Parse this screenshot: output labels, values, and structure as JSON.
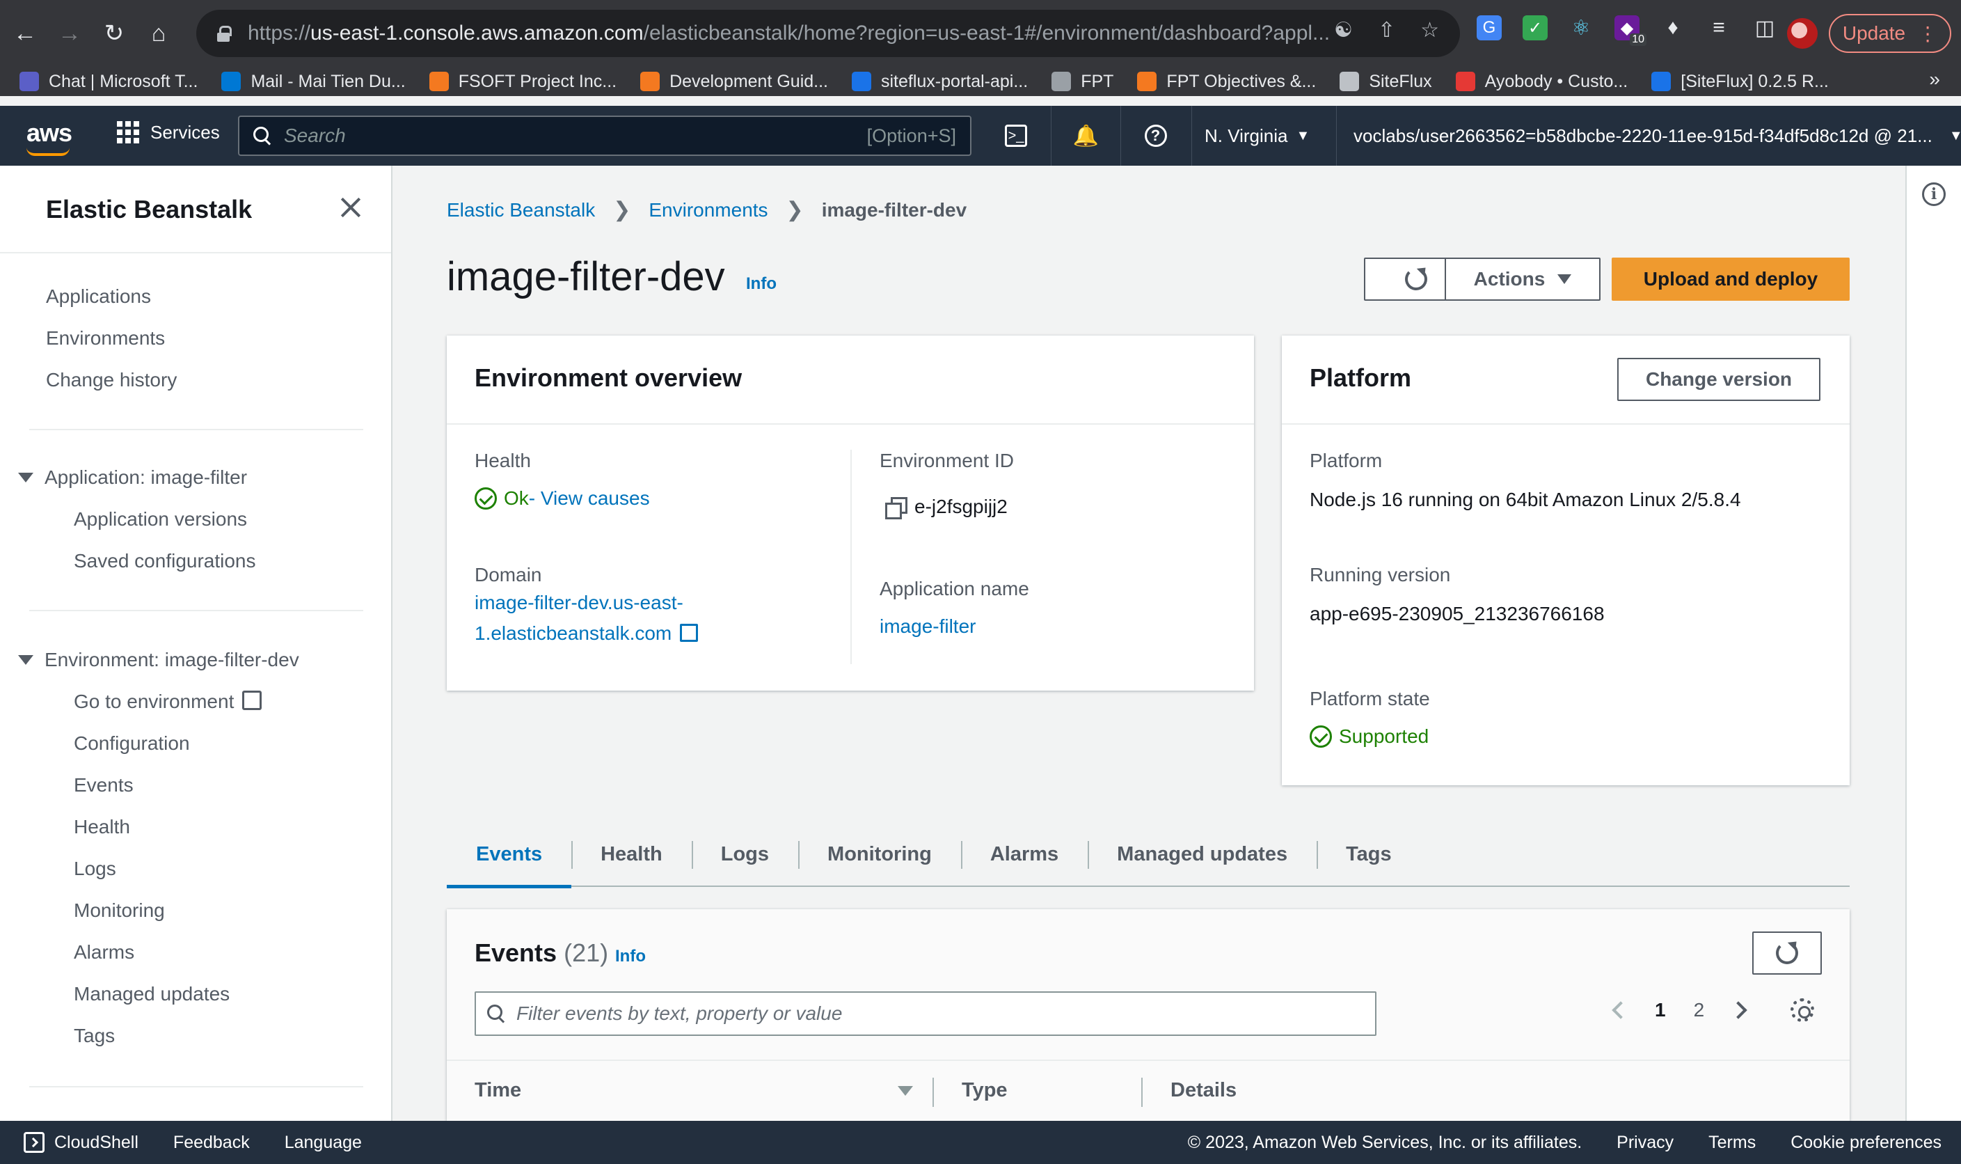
{
  "browser": {
    "url_prefix": "https://",
    "url_host": "us-east-1.console.aws.amazon.com",
    "url_path": "/elasticbeanstalk/home?region=us-east-1#/environment/dashboard?appl...",
    "update_label": "Update",
    "extension_badge": "10",
    "bookmarks": [
      {
        "label": "Chat | Microsoft T...",
        "color": "#5b5fc7"
      },
      {
        "label": "Mail - Mai Tien Du...",
        "color": "#0078d4"
      },
      {
        "label": "FSOFT Project Inc...",
        "color": "#f47920"
      },
      {
        "label": "Development Guid...",
        "color": "#f47920"
      },
      {
        "label": "siteflux-portal-api...",
        "color": "#1a73e8"
      },
      {
        "label": "FPT",
        "color": "#9aa0a6"
      },
      {
        "label": "FPT Objectives &...",
        "color": "#f47920"
      },
      {
        "label": "SiteFlux",
        "color": "#bdc1c6"
      },
      {
        "label": "Ayobody • Custo...",
        "color": "#e53935"
      },
      {
        "label": "[SiteFlux] 0.2.5 R...",
        "color": "#1a73e8"
      }
    ],
    "bookmarks_more": "»"
  },
  "aws_nav": {
    "logo": "aws",
    "services_label": "Services",
    "search_placeholder": "Search",
    "search_shortcut": "[Option+S]",
    "region": "N. Virginia",
    "account": "voclabs/user2663562=b58dbcbe-2220-11ee-915d-f34df5d8c12d @ 21..."
  },
  "sidebar": {
    "title": "Elastic Beanstalk",
    "top_links": [
      "Applications",
      "Environments",
      "Change history"
    ],
    "application_section": "Application: image-filter",
    "application_links": [
      "Application versions",
      "Saved configurations"
    ],
    "environment_section": "Environment: image-filter-dev",
    "environment_links": [
      "Go to environment",
      "Configuration",
      "Events",
      "Health",
      "Logs",
      "Monitoring",
      "Alarms",
      "Managed updates",
      "Tags"
    ]
  },
  "breadcrumb": {
    "root": "Elastic Beanstalk",
    "parent": "Environments",
    "current": "image-filter-dev"
  },
  "page": {
    "title": "image-filter-dev",
    "info": "Info",
    "actions_label": "Actions",
    "upload_label": "Upload and deploy"
  },
  "overview": {
    "title": "Environment overview",
    "health_label": "Health",
    "health_value": "Ok",
    "health_link": " - View causes",
    "env_id_label": "Environment ID",
    "env_id_value": "e-j2fsgpijj2",
    "domain_label": "Domain",
    "domain_line1": "image-filter-dev.us-east-",
    "domain_line2": "1.elasticbeanstalk.com",
    "app_name_label": "Application name",
    "app_name_value": "image-filter"
  },
  "platform": {
    "title": "Platform",
    "change_version_label": "Change version",
    "platform_label": "Platform",
    "platform_value": "Node.js 16 running on 64bit Amazon Linux 2/5.8.4",
    "running_version_label": "Running version",
    "running_version_value": "app-e695-230905_213236766168",
    "state_label": "Platform state",
    "state_value": "Supported"
  },
  "tabs": [
    "Events",
    "Health",
    "Logs",
    "Monitoring",
    "Alarms",
    "Managed updates",
    "Tags"
  ],
  "events": {
    "title": "Events",
    "count": "(21)",
    "info": "Info",
    "filter_placeholder": "Filter events by text, property or value",
    "pages": [
      "1",
      "2"
    ],
    "columns": [
      "Time",
      "Type",
      "Details"
    ]
  },
  "footer": {
    "cloudshell": "CloudShell",
    "feedback": "Feedback",
    "language": "Language",
    "copyright": "© 2023, Amazon Web Services, Inc. or its affiliates.",
    "privacy": "Privacy",
    "terms": "Terms",
    "cookies": "Cookie preferences"
  },
  "colors": {
    "aws_nav": "#232f3e",
    "link": "#0073bb",
    "primary_button": "#ec7211",
    "success": "#1d8102"
  }
}
